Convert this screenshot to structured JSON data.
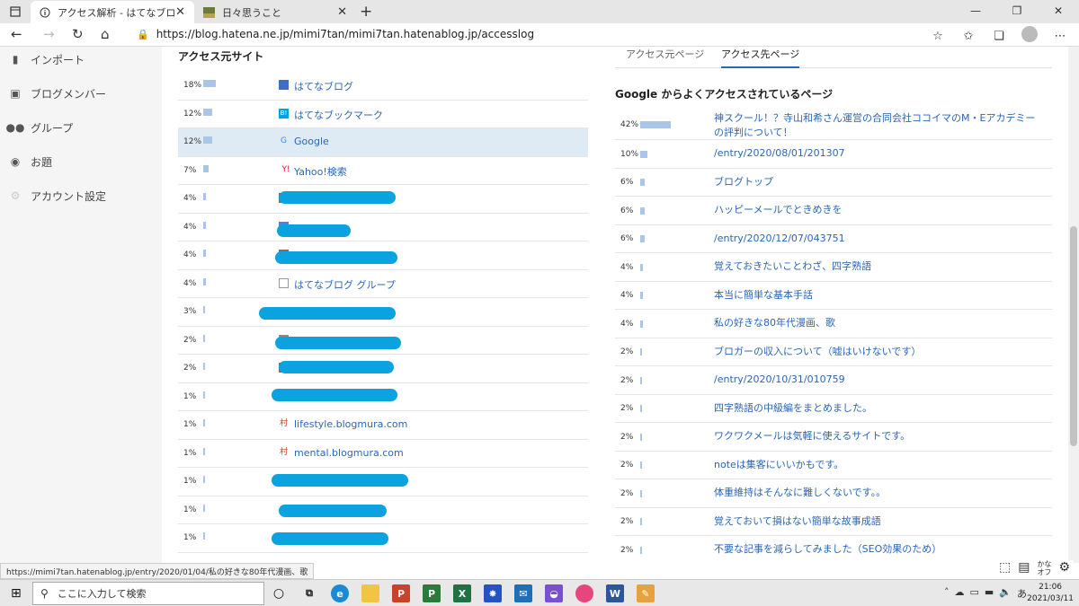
{
  "browser": {
    "tabs": [
      {
        "title": "アクセス解析 - はてなブログ",
        "active": true
      },
      {
        "title": "日々思うこと",
        "active": false
      }
    ],
    "url": "https://blog.hatena.ne.jp/mimi7tan/mimi7tan.hatenablog.jp/accesslog"
  },
  "sidebar": {
    "items": [
      {
        "label": "インポート",
        "icon": "truck-icon"
      },
      {
        "label": "ブログメンバー",
        "icon": "members-icon"
      },
      {
        "label": "グループ",
        "icon": "group-icon"
      },
      {
        "label": "お題",
        "icon": "topic-icon"
      },
      {
        "label": "アカウント設定",
        "icon": "gear-icon"
      }
    ]
  },
  "sources": {
    "title": "アクセス元サイト",
    "rows": [
      {
        "pct": "18%",
        "value": 18,
        "label": "はてなブログ",
        "icon": "hatena-blog-icon",
        "iconColor": "#3d6fc6"
      },
      {
        "pct": "12%",
        "value": 12,
        "label": "はてなブックマーク",
        "icon": "hatena-bookmark-icon",
        "iconColor": "#00a4de"
      },
      {
        "pct": "12%",
        "value": 12,
        "label": "Google",
        "icon": "google-icon",
        "iconColor": "#4285f4",
        "highlight": true
      },
      {
        "pct": "7%",
        "value": 7,
        "label": "Yahoo!検索",
        "icon": "yahoo-icon",
        "iconColor": "#ff0033"
      },
      {
        "pct": "4%",
        "value": 4,
        "label": "",
        "icon": "site-icon",
        "iconColor": "#8a6b4d"
      },
      {
        "pct": "4%",
        "value": 4,
        "label": "",
        "icon": "site-icon",
        "iconColor": "#5a7be0"
      },
      {
        "pct": "4%",
        "value": 4,
        "label": "",
        "icon": "site-icon",
        "iconColor": "#8a6b4d"
      },
      {
        "pct": "4%",
        "value": 4,
        "label": "はてなブログ グループ",
        "icon": "document-icon",
        "iconColor": "#999999"
      },
      {
        "pct": "3%",
        "value": 3,
        "label": "",
        "icon": "site-icon",
        "iconColor": "#ffffff"
      },
      {
        "pct": "2%",
        "value": 2,
        "label": "",
        "icon": "site-icon",
        "iconColor": "#8a8a8a"
      },
      {
        "pct": "2%",
        "value": 2,
        "label": "",
        "icon": "site-icon",
        "iconColor": "#8a6b4d"
      },
      {
        "pct": "1%",
        "value": 1,
        "label": "",
        "icon": "site-icon",
        "iconColor": "#8a6b4d"
      },
      {
        "pct": "1%",
        "value": 1,
        "label": "lifestyle.blogmura.com",
        "icon": "blogmura-icon",
        "iconColor": "#c0392b"
      },
      {
        "pct": "1%",
        "value": 1,
        "label": "mental.blogmura.com",
        "icon": "blogmura-icon",
        "iconColor": "#c0392b"
      },
      {
        "pct": "1%",
        "value": 1,
        "label": "",
        "icon": "site-icon",
        "iconColor": "#8a6b4d"
      },
      {
        "pct": "1%",
        "value": 1,
        "label": "",
        "icon": "site-icon",
        "iconColor": "#ffffff"
      },
      {
        "pct": "1%",
        "value": 1,
        "label": "",
        "icon": "site-icon",
        "iconColor": "#ffffff"
      }
    ]
  },
  "destinations": {
    "tabs": [
      "アクセス元ページ",
      "アクセス先ページ"
    ],
    "active_tab": 1,
    "title": "Google からよくアクセスされているページ",
    "rows": [
      {
        "pct": "42%",
        "value": 42,
        "label": "神スクール！？寺山和希さん運営の合同会社ココイマのM・Eアカデミーの評判について！"
      },
      {
        "pct": "10%",
        "value": 10,
        "label": "/entry/2020/08/01/201307"
      },
      {
        "pct": "6%",
        "value": 6,
        "label": "ブログトップ"
      },
      {
        "pct": "6%",
        "value": 6,
        "label": "ハッピーメールでときめきを"
      },
      {
        "pct": "6%",
        "value": 6,
        "label": "/entry/2020/12/07/043751"
      },
      {
        "pct": "4%",
        "value": 4,
        "label": "覚えておきたいことわざ、四字熟語"
      },
      {
        "pct": "4%",
        "value": 4,
        "label": "本当に簡単な基本手話"
      },
      {
        "pct": "4%",
        "value": 4,
        "label": "私の好きな80年代漫画、歌"
      },
      {
        "pct": "2%",
        "value": 2,
        "label": "ブロガーの収入について（嘘はいけないです）"
      },
      {
        "pct": "2%",
        "value": 2,
        "label": "/entry/2020/10/31/010759"
      },
      {
        "pct": "2%",
        "value": 2,
        "label": "四字熟語の中級編をまとめました。"
      },
      {
        "pct": "2%",
        "value": 2,
        "label": "ワクワクメールは気軽に使えるサイトです。"
      },
      {
        "pct": "2%",
        "value": 2,
        "label": "noteは集客にいいかもです。"
      },
      {
        "pct": "2%",
        "value": 2,
        "label": "体重維持はそんなに難しくないです。。"
      },
      {
        "pct": "2%",
        "value": 2,
        "label": "覚えておいて損はない簡単な故事成語"
      },
      {
        "pct": "2%",
        "value": 2,
        "label": "不要な記事を減らしてみました（SEO効果のため）"
      }
    ]
  },
  "status_url": "https://mimi7tan.hatenablog.jp/entry/2020/01/04/私の好きな80年代漫画、歌",
  "taskbar": {
    "search_placeholder": "ここに入力して検索",
    "time": "21:06",
    "date": "2021/03/11",
    "ime": "あ",
    "kana": "かな\nオフ"
  },
  "colors": {
    "link": "#2a66b5",
    "bar": "#a9c6e8",
    "highlight": "#deebf5",
    "redaction": "#0aa3e0"
  }
}
